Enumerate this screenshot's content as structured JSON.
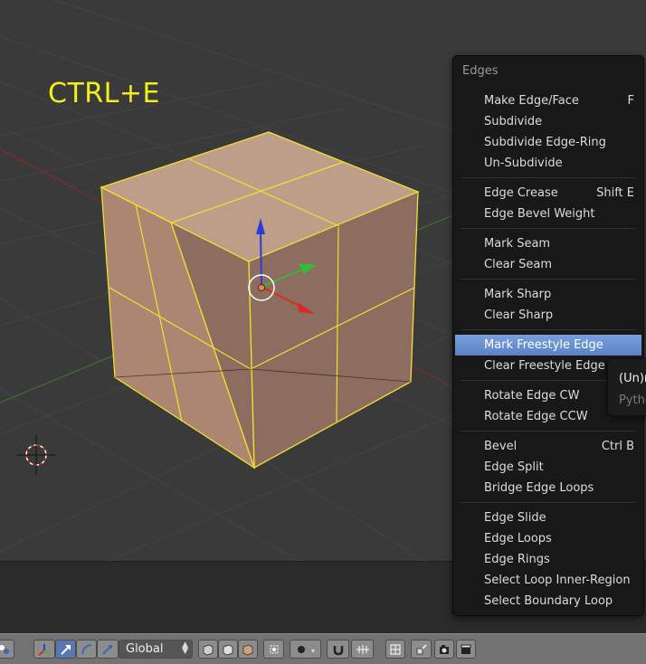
{
  "viewport": {
    "shortcut_hint": "CTRL+E"
  },
  "edges_menu": {
    "title": "Edges",
    "highlighted_item": "Mark Freestyle Edge",
    "items": [
      {
        "label": "Make Edge/Face",
        "shortcut": "F"
      },
      {
        "label": "Subdivide",
        "shortcut": ""
      },
      {
        "label": "Subdivide Edge-Ring",
        "shortcut": ""
      },
      {
        "label": "Un-Subdivide",
        "shortcut": ""
      },
      {
        "label": "Edge Crease",
        "shortcut": "Shift E"
      },
      {
        "label": "Edge Bevel Weight",
        "shortcut": ""
      },
      {
        "label": "Mark Seam",
        "shortcut": ""
      },
      {
        "label": "Clear Seam",
        "shortcut": ""
      },
      {
        "label": "Mark Sharp",
        "shortcut": ""
      },
      {
        "label": "Clear Sharp",
        "shortcut": ""
      },
      {
        "label": "Mark Freestyle Edge",
        "shortcut": ""
      },
      {
        "label": "Clear Freestyle Edge",
        "shortcut": ""
      },
      {
        "label": "Rotate Edge CW",
        "shortcut": ""
      },
      {
        "label": "Rotate Edge CCW",
        "shortcut": ""
      },
      {
        "label": "Bevel",
        "shortcut": "Ctrl B"
      },
      {
        "label": "Edge Split",
        "shortcut": ""
      },
      {
        "label": "Bridge Edge Loops",
        "shortcut": ""
      },
      {
        "label": "Edge Slide",
        "shortcut": ""
      },
      {
        "label": "Edge Loops",
        "shortcut": ""
      },
      {
        "label": "Edge Rings",
        "shortcut": ""
      },
      {
        "label": "Select Loop Inner-Region",
        "shortcut": ""
      },
      {
        "label": "Select Boundary Loop",
        "shortcut": ""
      }
    ]
  },
  "tooltip": {
    "title": "(Un)r",
    "subtitle": "Pytho"
  },
  "header": {
    "transform_orientation": "Global"
  },
  "colors": {
    "accent_highlight": "#5a82c4",
    "selection": "#f0e030",
    "face_fill": "#d8a888",
    "menu_bg": "#181818",
    "hint_text": "#f2f01a"
  }
}
